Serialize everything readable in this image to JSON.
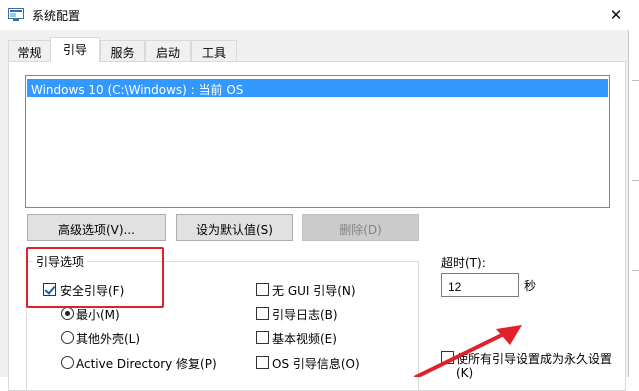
{
  "window": {
    "title": "系统配置",
    "close_glyph": "✕"
  },
  "tabs": [
    {
      "label": "常规"
    },
    {
      "label": "引导"
    },
    {
      "label": "服务"
    },
    {
      "label": "启动"
    },
    {
      "label": "工具"
    }
  ],
  "active_tab": "引导",
  "os_list": {
    "items": [
      "Windows 10 (C:\\Windows) : 当前 OS"
    ],
    "selected_index": 0
  },
  "buttons": {
    "advanced": "高级选项(V)...",
    "set_default": "设为默认值(S)",
    "delete": "删除(D)"
  },
  "boot_options": {
    "title": "引导选项",
    "safe_boot": {
      "label": "安全引导(F)",
      "checked": true
    },
    "radios": [
      {
        "label": "最小(M)",
        "checked": true
      },
      {
        "label": "其他外壳(L)",
        "checked": false
      },
      {
        "label": "Active Directory 修复(P)",
        "checked": false
      }
    ],
    "checkboxes": [
      {
        "label": "无 GUI 引导(N)",
        "checked": false
      },
      {
        "label": "引导日志(B)",
        "checked": false
      },
      {
        "label": "基本视频(E)",
        "checked": false
      },
      {
        "label": "OS 引导信息(O)",
        "checked": false
      }
    ]
  },
  "timeout": {
    "label": "超时(T):",
    "value": "12",
    "unit": "秒"
  },
  "permanent": {
    "label": "使所有引导设置成为永久设置",
    "shortcut": "(K)",
    "checked": false
  },
  "colors": {
    "selection": "#3399ff",
    "highlight": "#e0202a",
    "window_bg": "#f0f0f0"
  }
}
